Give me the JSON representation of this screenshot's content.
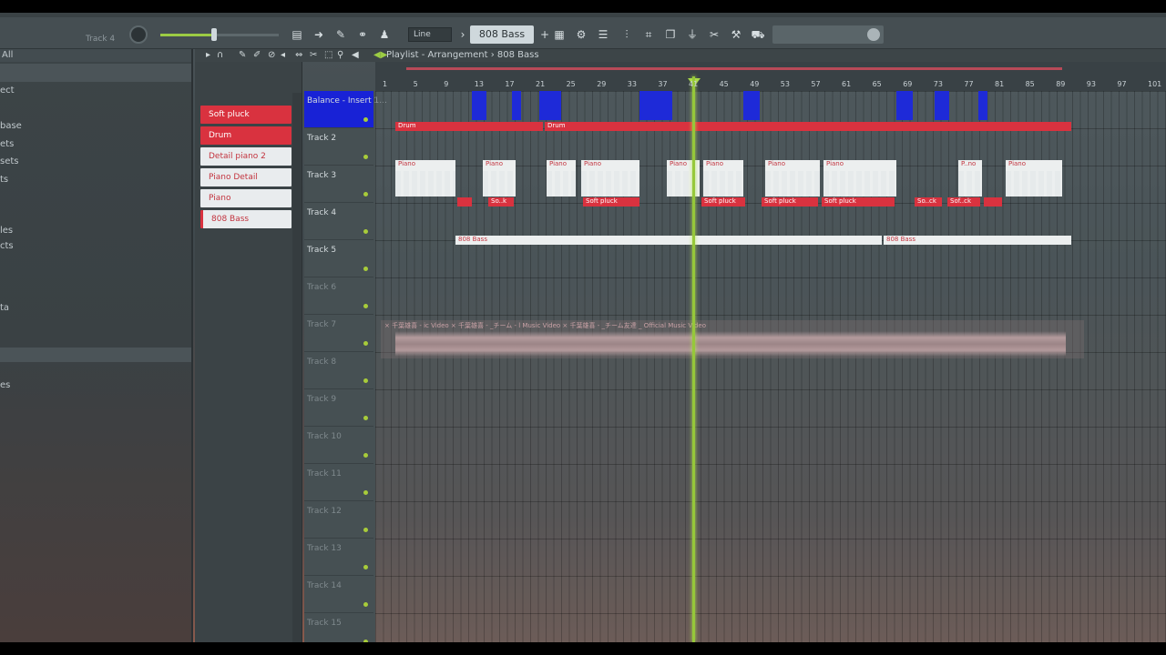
{
  "toolbar": {
    "current_track": "Track 4",
    "snap_mode": "Line",
    "current_pattern": "808 Bass"
  },
  "browser": {
    "header": "All",
    "items": [
      "ect",
      "base",
      "ets",
      "sets",
      "ts",
      "les",
      "cts",
      "ta",
      "es"
    ]
  },
  "playlist": {
    "title": "Playlist - Arrangement",
    "pattern": "808 Bass"
  },
  "picker": {
    "items": [
      {
        "label": "Soft pluck",
        "style": "red"
      },
      {
        "label": "Drum",
        "style": "red"
      },
      {
        "label": "Detail piano 2",
        "style": "white"
      },
      {
        "label": "Piano Detail",
        "style": "white"
      },
      {
        "label": "Piano",
        "style": "white"
      },
      {
        "label": "808 Bass",
        "style": "white"
      }
    ]
  },
  "tracks": [
    "Balance - Insert 1...",
    "Track 2",
    "Track 3",
    "Track 4",
    "Track 5",
    "Track 6",
    "Track 7",
    "Track 8",
    "Track 9",
    "Track 10",
    "Track 11",
    "Track 12",
    "Track 13",
    "Track 14",
    "Track 15"
  ],
  "ruler": {
    "bars": [
      "1",
      "5",
      "9",
      "13",
      "17",
      "21",
      "25",
      "29",
      "33",
      "37",
      "41",
      "45",
      "49",
      "53",
      "57",
      "61",
      "65",
      "69",
      "73",
      "77",
      "81",
      "85",
      "89",
      "93",
      "97",
      "101"
    ]
  },
  "clips": {
    "drum_label": "Drum",
    "piano_label": "Piano",
    "piano_short": "P..no",
    "soft_label": "Soft pluck",
    "so_short": "So..k",
    "so_short2": "So..ck",
    "sof_short": "Sof..ck",
    "bass_label": "808 Bass",
    "audio_caption": "× 千葉雄喜 - ic Video × 千葉雄喜 - _チーム - l Music Video × 千葉雄喜 - _チーム友達 _ Official Music Video"
  }
}
